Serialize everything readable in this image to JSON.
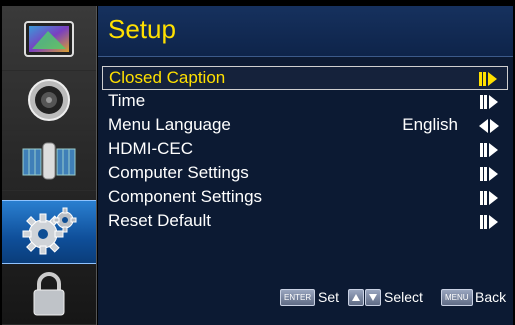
{
  "sidebar": {
    "items": [
      {
        "icon": "picture-icon",
        "active": false
      },
      {
        "icon": "speaker-icon",
        "active": false
      },
      {
        "icon": "satellite-icon",
        "active": false
      },
      {
        "icon": "gear-icon",
        "active": true
      },
      {
        "icon": "lock-icon",
        "active": false
      }
    ]
  },
  "header": {
    "title": "Setup"
  },
  "menu": {
    "items": [
      {
        "label": "Closed Caption",
        "value": "",
        "arrow": "right",
        "selected": true
      },
      {
        "label": "Time",
        "value": "",
        "arrow": "right",
        "selected": false
      },
      {
        "label": "Menu Language",
        "value": "English",
        "arrow": "left-right",
        "selected": false
      },
      {
        "label": "HDMI-CEC",
        "value": "",
        "arrow": "right",
        "selected": false
      },
      {
        "label": "Computer Settings",
        "value": "",
        "arrow": "right",
        "selected": false
      },
      {
        "label": "Component Settings",
        "value": "",
        "arrow": "right",
        "selected": false
      },
      {
        "label": "Reset Default",
        "value": "",
        "arrow": "right",
        "selected": false
      }
    ]
  },
  "footer": {
    "enter_key": "ENTER",
    "set_label": "Set",
    "select_label": "Select",
    "menu_key": "MENU",
    "back_label": "Back"
  },
  "colors": {
    "highlight": "#ffe000",
    "panel": "#0c1a33",
    "sidebar_active": "#1a6bc0"
  }
}
